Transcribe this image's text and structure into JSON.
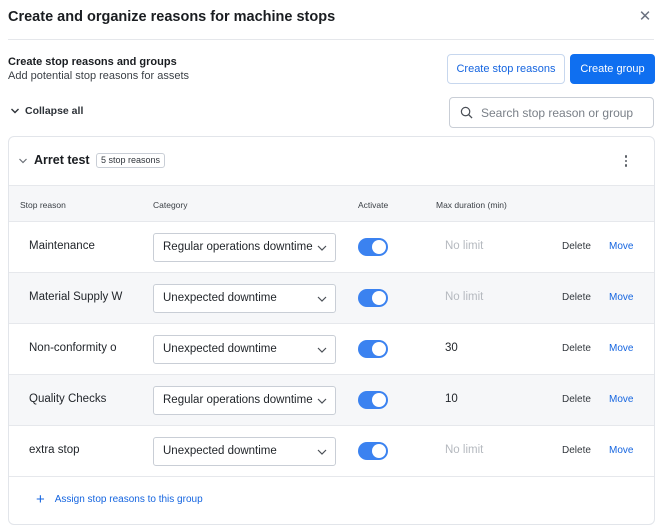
{
  "modal": {
    "title": "Create and organize reasons for machine stops",
    "close_icon": "close-icon"
  },
  "section": {
    "title": "Create stop reasons and groups",
    "subtitle": "Add potential stop reasons for assets",
    "create_reasons_label": "Create stop reasons",
    "create_group_label": "Create group"
  },
  "collapse_label": "Collapse all",
  "search": {
    "placeholder": "Search stop reason or group",
    "value": ""
  },
  "group": {
    "name": "Arret test",
    "badge": "5 stop reasons",
    "columns": {
      "reason": "Stop reason",
      "category": "Category",
      "activate": "Activate",
      "max_duration": "Max duration (min)"
    },
    "rows": [
      {
        "reason": "Maintenance",
        "category": "Regular operations downtime",
        "active": true,
        "max_duration": "No limit",
        "delete": "Delete",
        "move": "Move"
      },
      {
        "reason": "Material Supply W",
        "category": "Unexpected downtime",
        "active": true,
        "max_duration": "No limit",
        "delete": "Delete",
        "move": "Move"
      },
      {
        "reason": "Non-conformity o",
        "category": "Unexpected downtime",
        "active": true,
        "max_duration": "30",
        "delete": "Delete",
        "move": "Move"
      },
      {
        "reason": "Quality Checks",
        "category": "Regular operations downtime",
        "active": true,
        "max_duration": "10",
        "delete": "Delete",
        "move": "Move"
      },
      {
        "reason": "extra stop",
        "category": "Unexpected downtime",
        "active": true,
        "max_duration": "No limit",
        "delete": "Delete",
        "move": "Move"
      }
    ],
    "assign_label": "Assign stop reasons to this group"
  },
  "colors": {
    "primary": "#0f6ff0",
    "link": "#1565e0",
    "toggle_on": "#3b82f0",
    "row_alt": "#f6f7f9"
  }
}
